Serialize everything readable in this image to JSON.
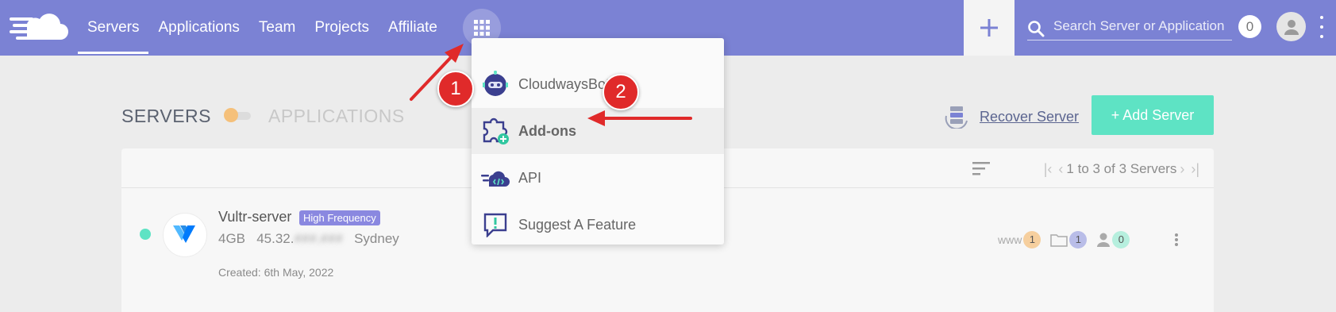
{
  "nav": {
    "items": [
      {
        "label": "Servers",
        "active": true
      },
      {
        "label": "Applications",
        "active": false
      },
      {
        "label": "Team",
        "active": false
      },
      {
        "label": "Projects",
        "active": false
      },
      {
        "label": "Affiliate",
        "active": false
      }
    ],
    "search_placeholder": "Search Server or Application",
    "notification_count": "0"
  },
  "dropdown": {
    "items": [
      {
        "label": "CloudwaysBot",
        "icon": "robot-icon"
      },
      {
        "label": "Add-ons",
        "icon": "puzzle-addon-icon",
        "highlighted": true
      },
      {
        "label": "API",
        "icon": "api-cloud-icon"
      },
      {
        "label": "Suggest A Feature",
        "icon": "suggest-feature-icon"
      }
    ]
  },
  "section": {
    "servers_tab": "SERVERS",
    "applications_tab": "APPLICATIONS",
    "recover_label": "Recover Server",
    "add_server_label": "+ Add Server"
  },
  "pager": {
    "text": "1 to 3 of 3 Servers"
  },
  "server": {
    "name": "Vultr-server",
    "badge": "High Frequency",
    "size": "4GB",
    "ip_visible": "45.32.",
    "ip_blurred": "###.###",
    "location": "Sydney",
    "created": "Created: 6th May, 2022",
    "stats": {
      "www": "1",
      "folders": "1",
      "users": "0"
    },
    "www_label": "www"
  },
  "annotations": {
    "step1": "1",
    "step2": "2"
  },
  "colors": {
    "topbar": "#7b82d4",
    "accent_green": "#5ee3c4",
    "callout_red": "#e02a2a",
    "badge": "#8a88e0"
  }
}
